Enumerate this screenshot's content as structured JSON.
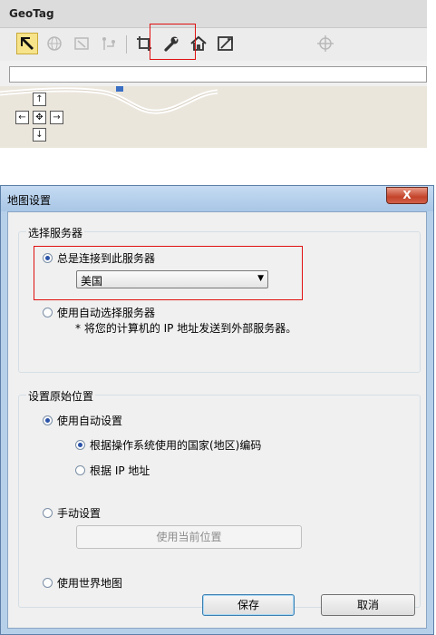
{
  "geotag": {
    "title": "GeoTag",
    "toolbar": [
      {
        "name": "pointer-tool-icon",
        "selected": true
      },
      {
        "name": "globe-tool-icon",
        "disabled": true
      },
      {
        "name": "map-frame-tool-icon",
        "disabled": true
      },
      {
        "name": "route-tool-icon",
        "disabled": true
      },
      {
        "name": "crop-tool-icon"
      },
      {
        "name": "wrench-settings-icon"
      },
      {
        "name": "home-icon"
      },
      {
        "name": "map-edit-icon"
      },
      {
        "name": "crosshair-icon",
        "disabled": true
      }
    ],
    "search_value": "",
    "nav": {
      "up": "↑",
      "left": "←",
      "center": "✥",
      "right": "→",
      "down": "↓"
    }
  },
  "dialog": {
    "title": "地图设置",
    "close_label": "X",
    "server_group": {
      "title": "选择服务器",
      "always_connect_label": "总是连接到此服务器",
      "always_connect_checked": true,
      "selected_server": "美国",
      "auto_select_label": "使用自动选择服务器",
      "auto_select_checked": false,
      "auto_select_note": "* 将您的计算机的 IP 地址发送到外部服务器。"
    },
    "location_group": {
      "title": "设置原始位置",
      "auto_setting_label": "使用自动设置",
      "auto_setting_checked": true,
      "by_os_label": "根据操作系统使用的国家(地区)编码",
      "by_os_checked": true,
      "by_ip_label": "根据 IP 地址",
      "by_ip_checked": false,
      "manual_label": "手动设置",
      "manual_checked": false,
      "use_current_label": "使用当前位置",
      "world_map_label": "使用世界地图",
      "world_map_checked": false
    },
    "save_label": "保存",
    "cancel_label": "取消"
  },
  "colors": {
    "highlight": "#e01010",
    "accent": "#2a52a8"
  }
}
